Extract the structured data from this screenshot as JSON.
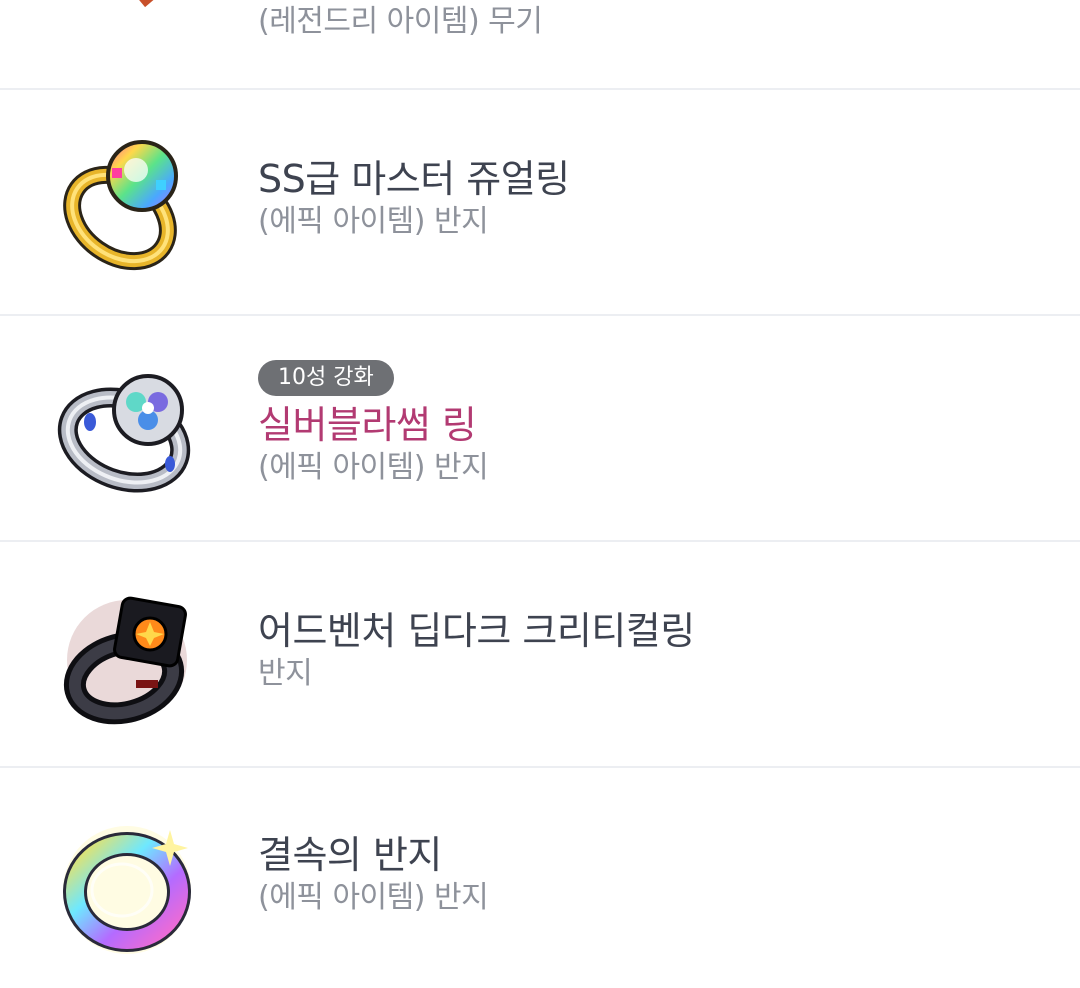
{
  "items": [
    {
      "name": "",
      "sub": "(레전드리 아이템) 무기",
      "icon": "legendary-weapon-icon"
    },
    {
      "name": "SS급 마스터 쥬얼링",
      "sub": "(에픽 아이템) 반지",
      "icon": "rainbow-jewel-ring-icon"
    },
    {
      "badge": "10성 강화",
      "name": "실버블라썸 링",
      "sub": "(에픽 아이템) 반지",
      "icon": "silver-blossom-ring-icon",
      "name_color": "#b23a72"
    },
    {
      "name": "어드벤처 딥다크 크리티컬링",
      "sub": "반지",
      "icon": "dark-critical-ring-icon"
    },
    {
      "name": "결속의 반지",
      "sub": "(에픽 아이템) 반지",
      "icon": "bond-ring-icon"
    }
  ],
  "colors": {
    "name_text": "#3e4350",
    "sub_text": "#8e929b",
    "badge_bg": "#6e7074",
    "divider": "#eceef2"
  }
}
